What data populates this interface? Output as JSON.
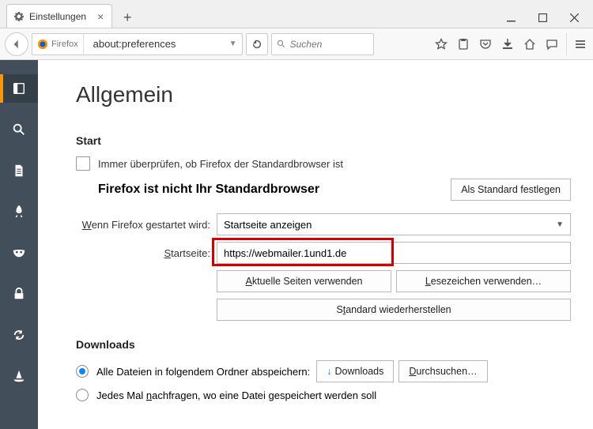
{
  "window": {
    "tab_title": "Einstellungen"
  },
  "nav": {
    "brand": "Firefox",
    "url": "about:preferences",
    "search_placeholder": "Suchen"
  },
  "page": {
    "title": "Allgemein",
    "start_heading": "Start",
    "check_default_label": "Immer überprüfen, ob Firefox der Standardbrowser ist",
    "not_default_label": "Firefox ist nicht Ihr Standardbrowser",
    "set_default_btn": "Als Standard festlegen",
    "when_start_label": "Wenn Firefox gestartet wird:",
    "when_start_value": "Startseite anzeigen",
    "homepage_label": "Startseite:",
    "homepage_value": "https://webmailer.1und1.de",
    "use_current_btn": "Aktuelle Seiten verwenden",
    "use_bookmark_btn": "Lesezeichen verwenden…",
    "restore_default_btn": "Standard wiederherstellen",
    "downloads_heading": "Downloads",
    "save_to_label": "Alle Dateien in folgendem Ordner abspeichern:",
    "downloads_folder": "Downloads",
    "browse_btn": "Durchsuchen…",
    "ask_each_label": "Jedes Mal nachfragen, wo eine Datei gespeichert werden soll"
  }
}
